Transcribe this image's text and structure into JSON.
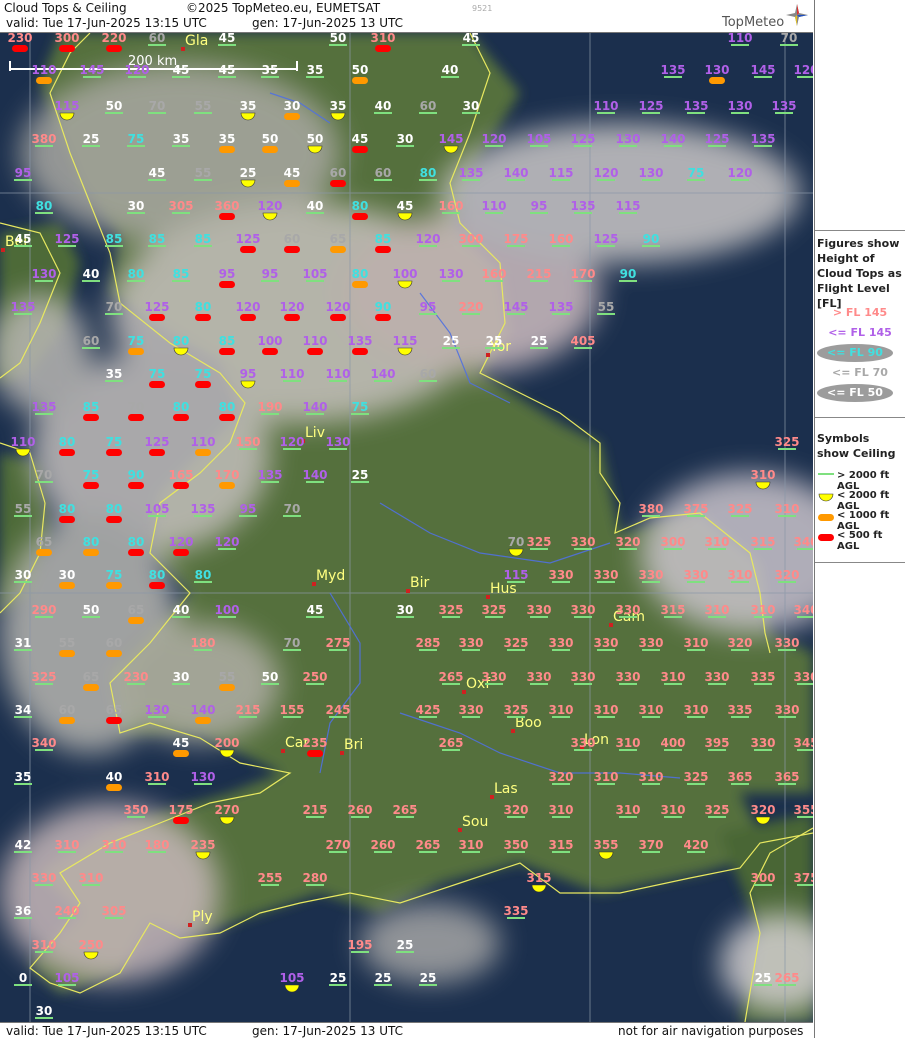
{
  "header": {
    "title": "Cloud Tops & Ceiling",
    "copyright": "©2025 TopMeteo.eu, EUMETSAT",
    "valid": "valid:  Tue  17-Jun-2025  13:15 UTC",
    "generated": "gen: 17-Jun-2025 13 UTC",
    "code": "9521",
    "brand": "TopMeteo"
  },
  "footer": {
    "valid": "valid:  Tue  17-Jun-2025  13:15 UTC",
    "generated": "gen: 17-Jun-2025 13 UTC",
    "disclaimer": "not for air navigation purposes"
  },
  "map": {
    "scale_label": "200 km",
    "cities": [
      {
        "name": "Gla"
      },
      {
        "name": "Bel"
      },
      {
        "name": "Yor"
      },
      {
        "name": "Liv"
      },
      {
        "name": "Myd"
      },
      {
        "name": "Bir"
      },
      {
        "name": "Hus"
      },
      {
        "name": "Cam"
      },
      {
        "name": "Oxf"
      },
      {
        "name": "Boo"
      },
      {
        "name": "Lon"
      },
      {
        "name": "Car"
      },
      {
        "name": "Bri"
      },
      {
        "name": "Las"
      },
      {
        "name": "Sou"
      },
      {
        "name": "Ply"
      }
    ]
  },
  "legend": {
    "tops_heading": "Figures show Height of Cloud Tops as Flight Level  [FL]",
    "tops": [
      {
        "label": "> FL 145",
        "color": "#ff8a8a"
      },
      {
        "label": "<= FL 145",
        "color": "#b060e8"
      },
      {
        "label": "<= FL 90",
        "color": "#40e0e0"
      },
      {
        "label": "<= FL 70",
        "color": "#a8a8a8"
      },
      {
        "label": "<= FL 50",
        "color": "#ffffff"
      }
    ],
    "ceiling_heading": "Symbols show Ceiling",
    "ceiling": [
      {
        "label": "> 2000 ft AGL",
        "color": "#7fe07f"
      },
      {
        "label": "< 2000 ft AGL",
        "color": "#ffff00"
      },
      {
        "label": "< 1000 ft AGL",
        "color": "#ff9900"
      },
      {
        "label": "< 500 ft AGL",
        "color": "#ff0000"
      }
    ]
  },
  "colors": {
    "high": "#ff8a8a",
    "mid": "#b060e8",
    "low": "#40e0e0",
    "lower": "#a8a8a8",
    "lowest": "#ffffff",
    "coast": "#e8e860",
    "river": "#5070e0",
    "sea": "#1a2d4a",
    "land": "#4f6a3a"
  },
  "stations": [
    {
      "v": "230",
      "s": "r"
    },
    {
      "v": "300",
      "s": "r"
    },
    {
      "v": "220",
      "s": "r"
    },
    {
      "v": "60",
      "s": "g"
    },
    {
      "v": "45",
      "s": "g"
    },
    {
      "v": "50",
      "s": "g"
    },
    {
      "v": "310",
      "s": "r"
    },
    {
      "v": "45",
      "s": "g"
    },
    {
      "v": "110",
      "s": "g"
    },
    {
      "v": "70",
      "s": "g"
    },
    {
      "v": "110",
      "s": "o"
    },
    {
      "v": "145",
      "s": "g"
    },
    {
      "v": "120",
      "s": "g"
    },
    {
      "v": "45",
      "s": "g"
    },
    {
      "v": "45",
      "s": "g"
    },
    {
      "v": "35",
      "s": "g"
    },
    {
      "v": "35",
      "s": "g"
    },
    {
      "v": "50",
      "s": "o"
    },
    {
      "v": "40",
      "s": "g"
    },
    {
      "v": "135",
      "s": "g"
    },
    {
      "v": "130",
      "s": "o"
    },
    {
      "v": "145",
      "s": "g"
    },
    {
      "v": "120",
      "s": "g"
    },
    {
      "v": "115",
      "s": "y"
    },
    {
      "v": "50",
      "s": "g"
    },
    {
      "v": "70",
      "s": "g"
    },
    {
      "v": "55",
      "s": "g"
    },
    {
      "v": "35",
      "s": "y"
    },
    {
      "v": "30",
      "s": "o"
    },
    {
      "v": "35",
      "s": "y"
    },
    {
      "v": "40",
      "s": "g"
    },
    {
      "v": "60",
      "s": "g"
    },
    {
      "v": "30",
      "s": "g"
    },
    {
      "v": "110",
      "s": "g"
    },
    {
      "v": "125",
      "s": "g"
    },
    {
      "v": "135",
      "s": "g"
    },
    {
      "v": "130",
      "s": "g"
    },
    {
      "v": "135",
      "s": "g"
    },
    {
      "v": "380",
      "s": "g"
    },
    {
      "v": "25",
      "s": "g"
    },
    {
      "v": "75",
      "s": "g"
    },
    {
      "v": "35",
      "s": "g"
    },
    {
      "v": "35",
      "s": "o"
    },
    {
      "v": "50",
      "s": "o"
    },
    {
      "v": "50",
      "s": "y"
    },
    {
      "v": "45",
      "s": "r"
    },
    {
      "v": "30",
      "s": "g"
    },
    {
      "v": "145",
      "s": "y"
    },
    {
      "v": "120",
      "s": "g"
    },
    {
      "v": "105",
      "s": "g"
    },
    {
      "v": "125",
      "s": "g"
    },
    {
      "v": "130",
      "s": "g"
    },
    {
      "v": "140",
      "s": "g"
    },
    {
      "v": "125",
      "s": "g"
    },
    {
      "v": "135",
      "s": "g"
    },
    {
      "v": "95",
      "s": "g"
    },
    {
      "v": "45",
      "s": "g"
    },
    {
      "v": "55",
      "s": "g"
    },
    {
      "v": "25",
      "s": "y"
    },
    {
      "v": "45",
      "s": "o"
    },
    {
      "v": "60",
      "s": "r"
    },
    {
      "v": "60",
      "s": "g"
    },
    {
      "v": "80",
      "s": "g"
    },
    {
      "v": "135",
      "s": "g"
    },
    {
      "v": "140",
      "s": "g"
    },
    {
      "v": "115",
      "s": "g"
    },
    {
      "v": "120",
      "s": "g"
    },
    {
      "v": "130",
      "s": "g"
    },
    {
      "v": "75",
      "s": "g"
    },
    {
      "v": "120",
      "s": "g"
    },
    {
      "v": "80",
      "s": "g"
    },
    {
      "v": "30",
      "s": "g"
    },
    {
      "v": "305",
      "s": "g"
    },
    {
      "v": "360",
      "s": "r"
    },
    {
      "v": "120",
      "s": "y"
    },
    {
      "v": "40",
      "s": "g"
    },
    {
      "v": "80",
      "s": "r"
    },
    {
      "v": "45",
      "s": "y"
    },
    {
      "v": "160",
      "s": "g"
    },
    {
      "v": "110",
      "s": "g"
    },
    {
      "v": "95",
      "s": "g"
    },
    {
      "v": "135",
      "s": "g"
    },
    {
      "v": "115",
      "s": "g"
    },
    {
      "v": "45",
      "s": "g"
    },
    {
      "v": "125",
      "s": "g"
    },
    {
      "v": "85",
      "s": "g"
    },
    {
      "v": "85",
      "s": "g"
    },
    {
      "v": "85",
      "s": "g"
    },
    {
      "v": "125",
      "s": "r"
    },
    {
      "v": "60",
      "s": "r"
    },
    {
      "v": "65",
      "s": "o"
    },
    {
      "v": "85",
      "s": "r"
    },
    {
      "v": "120",
      "s": "g"
    },
    {
      "v": "300",
      "s": "g"
    },
    {
      "v": "175",
      "s": "g"
    },
    {
      "v": "160",
      "s": "g"
    },
    {
      "v": "125",
      "s": "g"
    },
    {
      "v": "90",
      "s": "g"
    },
    {
      "v": "130",
      "s": "g"
    },
    {
      "v": "40",
      "s": "g"
    },
    {
      "v": "80",
      "s": "g"
    },
    {
      "v": "85",
      "s": "g"
    },
    {
      "v": "95",
      "s": "r"
    },
    {
      "v": "95",
      "s": "g"
    },
    {
      "v": "105",
      "s": "g"
    },
    {
      "v": "80",
      "s": "o"
    },
    {
      "v": "100",
      "s": "y"
    },
    {
      "v": "130",
      "s": "g"
    },
    {
      "v": "160",
      "s": "g"
    },
    {
      "v": "215",
      "s": "g"
    },
    {
      "v": "170",
      "s": "g"
    },
    {
      "v": "90",
      "s": "g"
    },
    {
      "v": "135",
      "s": "g"
    },
    {
      "v": "70",
      "s": "g"
    },
    {
      "v": "125",
      "s": "r"
    },
    {
      "v": "80",
      "s": "r"
    },
    {
      "v": "120",
      "s": "r"
    },
    {
      "v": "120",
      "s": "r"
    },
    {
      "v": "120",
      "s": "r"
    },
    {
      "v": "90",
      "s": "r"
    },
    {
      "v": "95",
      "s": "g"
    },
    {
      "v": "220",
      "s": "g"
    },
    {
      "v": "145",
      "s": "g"
    },
    {
      "v": "135",
      "s": "g"
    },
    {
      "v": "55",
      "s": "g"
    },
    {
      "v": "60",
      "s": "g"
    },
    {
      "v": "75",
      "s": "o"
    },
    {
      "v": "80",
      "s": "y"
    },
    {
      "v": "85",
      "s": "r"
    },
    {
      "v": "100",
      "s": "r"
    },
    {
      "v": "110",
      "s": "r"
    },
    {
      "v": "135",
      "s": "r"
    },
    {
      "v": "115",
      "s": "y"
    },
    {
      "v": "25",
      "s": "g"
    },
    {
      "v": "25",
      "s": "g"
    },
    {
      "v": "25",
      "s": "g"
    },
    {
      "v": "405",
      "s": "g"
    },
    {
      "v": "35",
      "s": "g"
    },
    {
      "v": "75",
      "s": "r"
    },
    {
      "v": "75",
      "s": "r"
    },
    {
      "v": "95",
      "s": "y"
    },
    {
      "v": "110",
      "s": "g"
    },
    {
      "v": "110",
      "s": "g"
    },
    {
      "v": "140",
      "s": "g"
    },
    {
      "v": "60",
      "s": "g"
    },
    {
      "v": "135",
      "s": "g"
    },
    {
      "v": "85",
      "s": "r"
    },
    {
      "v": "70",
      "s": "r"
    },
    {
      "v": "80",
      "s": "r"
    },
    {
      "v": "80",
      "s": "r"
    },
    {
      "v": "190",
      "s": "g"
    },
    {
      "v": "140",
      "s": "g"
    },
    {
      "v": "75",
      "s": "g"
    },
    {
      "v": "110",
      "s": "y"
    },
    {
      "v": "80",
      "s": "r"
    },
    {
      "v": "75",
      "s": "r"
    },
    {
      "v": "125",
      "s": "r"
    },
    {
      "v": "110",
      "s": "o"
    },
    {
      "v": "150",
      "s": "g"
    },
    {
      "v": "120",
      "s": "g"
    },
    {
      "v": "130",
      "s": "g"
    },
    {
      "v": "325",
      "s": "g"
    },
    {
      "v": "70",
      "s": "g"
    },
    {
      "v": "75",
      "s": "r"
    },
    {
      "v": "90",
      "s": "r"
    },
    {
      "v": "165",
      "s": "r"
    },
    {
      "v": "170",
      "s": "o"
    },
    {
      "v": "135",
      "s": "g"
    },
    {
      "v": "140",
      "s": "g"
    },
    {
      "v": "25",
      "s": "g"
    },
    {
      "v": "310",
      "s": "y"
    },
    {
      "v": "55",
      "s": "g"
    },
    {
      "v": "80",
      "s": "r"
    },
    {
      "v": "80",
      "s": "r"
    },
    {
      "v": "105",
      "s": "g"
    },
    {
      "v": "135",
      "s": "g"
    },
    {
      "v": "95",
      "s": "g"
    },
    {
      "v": "70",
      "s": "g"
    },
    {
      "v": "380",
      "s": "g"
    },
    {
      "v": "375",
      "s": "g"
    },
    {
      "v": "325",
      "s": "g"
    },
    {
      "v": "310",
      "s": "g"
    },
    {
      "v": "65",
      "s": "o"
    },
    {
      "v": "80",
      "s": "o"
    },
    {
      "v": "80",
      "s": "r"
    },
    {
      "v": "120",
      "s": "r"
    },
    {
      "v": "120",
      "s": "g"
    },
    {
      "v": "70",
      "s": "y"
    },
    {
      "v": "325",
      "s": "g"
    },
    {
      "v": "330",
      "s": "g"
    },
    {
      "v": "320",
      "s": "g"
    },
    {
      "v": "300",
      "s": "g"
    },
    {
      "v": "310",
      "s": "g"
    },
    {
      "v": "315",
      "s": "g"
    },
    {
      "v": "340",
      "s": "g"
    },
    {
      "v": "30",
      "s": "g"
    },
    {
      "v": "30",
      "s": "o"
    },
    {
      "v": "75",
      "s": "o"
    },
    {
      "v": "80",
      "s": "r"
    },
    {
      "v": "80",
      "s": "g"
    },
    {
      "v": "115",
      "s": "g"
    },
    {
      "v": "330",
      "s": "g"
    },
    {
      "v": "330",
      "s": "g"
    },
    {
      "v": "330",
      "s": "g"
    },
    {
      "v": "330",
      "s": "g"
    },
    {
      "v": "310",
      "s": "g"
    },
    {
      "v": "320",
      "s": "g"
    },
    {
      "v": "290",
      "s": "g"
    },
    {
      "v": "50",
      "s": "g"
    },
    {
      "v": "65",
      "s": "o"
    },
    {
      "v": "40",
      "s": "g"
    },
    {
      "v": "100",
      "s": "g"
    },
    {
      "v": "45",
      "s": "g"
    },
    {
      "v": "30",
      "s": "g"
    },
    {
      "v": "325",
      "s": "g"
    },
    {
      "v": "325",
      "s": "g"
    },
    {
      "v": "330",
      "s": "g"
    },
    {
      "v": "330",
      "s": "g"
    },
    {
      "v": "330",
      "s": "g"
    },
    {
      "v": "315",
      "s": "g"
    },
    {
      "v": "310",
      "s": "g"
    },
    {
      "v": "310",
      "s": "g"
    },
    {
      "v": "340",
      "s": "g"
    },
    {
      "v": "31",
      "s": "g"
    },
    {
      "v": "55",
      "s": "o"
    },
    {
      "v": "60",
      "s": "o"
    },
    {
      "v": "180",
      "s": "g"
    },
    {
      "v": "70",
      "s": "g"
    },
    {
      "v": "275",
      "s": "g"
    },
    {
      "v": "285",
      "s": "g"
    },
    {
      "v": "330",
      "s": "g"
    },
    {
      "v": "325",
      "s": "g"
    },
    {
      "v": "330",
      "s": "g"
    },
    {
      "v": "330",
      "s": "g"
    },
    {
      "v": "330",
      "s": "g"
    },
    {
      "v": "310",
      "s": "g"
    },
    {
      "v": "320",
      "s": "g"
    },
    {
      "v": "330",
      "s": "g"
    },
    {
      "v": "325",
      "s": "g"
    },
    {
      "v": "65",
      "s": "o"
    },
    {
      "v": "230",
      "s": "g"
    },
    {
      "v": "30",
      "s": "g"
    },
    {
      "v": "55",
      "s": "o"
    },
    {
      "v": "50",
      "s": "g"
    },
    {
      "v": "250",
      "s": "g"
    },
    {
      "v": "265",
      "s": "g"
    },
    {
      "v": "330",
      "s": "g"
    },
    {
      "v": "330",
      "s": "g"
    },
    {
      "v": "330",
      "s": "g"
    },
    {
      "v": "330",
      "s": "g"
    },
    {
      "v": "310",
      "s": "g"
    },
    {
      "v": "330",
      "s": "g"
    },
    {
      "v": "335",
      "s": "g"
    },
    {
      "v": "330",
      "s": "g"
    },
    {
      "v": "34",
      "s": "g"
    },
    {
      "v": "60",
      "s": "o"
    },
    {
      "v": "65",
      "s": "r"
    },
    {
      "v": "130",
      "s": "g"
    },
    {
      "v": "140",
      "s": "o"
    },
    {
      "v": "215",
      "s": "g"
    },
    {
      "v": "155",
      "s": "g"
    },
    {
      "v": "245",
      "s": "g"
    },
    {
      "v": "425",
      "s": "g"
    },
    {
      "v": "330",
      "s": "g"
    },
    {
      "v": "325",
      "s": "g"
    },
    {
      "v": "310",
      "s": "g"
    },
    {
      "v": "310",
      "s": "g"
    },
    {
      "v": "310",
      "s": "g"
    },
    {
      "v": "310",
      "s": "g"
    },
    {
      "v": "335",
      "s": "g"
    },
    {
      "v": "330",
      "s": "g"
    },
    {
      "v": "340",
      "s": "g"
    },
    {
      "v": "45",
      "s": "o"
    },
    {
      "v": "200",
      "s": "y"
    },
    {
      "v": "235",
      "s": "r"
    },
    {
      "v": "265",
      "s": "g"
    },
    {
      "v": "330",
      "s": "g"
    },
    {
      "v": "310",
      "s": "g"
    },
    {
      "v": "400",
      "s": "g"
    },
    {
      "v": "395",
      "s": "g"
    },
    {
      "v": "330",
      "s": "g"
    },
    {
      "v": "345",
      "s": "g"
    },
    {
      "v": "35",
      "s": "g"
    },
    {
      "v": "40",
      "s": "o"
    },
    {
      "v": "310",
      "s": "g"
    },
    {
      "v": "130",
      "s": "g"
    },
    {
      "v": "320",
      "s": "g"
    },
    {
      "v": "310",
      "s": "g"
    },
    {
      "v": "310",
      "s": "g"
    },
    {
      "v": "325",
      "s": "g"
    },
    {
      "v": "365",
      "s": "g"
    },
    {
      "v": "365",
      "s": "g"
    },
    {
      "v": "350",
      "s": "g"
    },
    {
      "v": "175",
      "s": "r"
    },
    {
      "v": "270",
      "s": "y"
    },
    {
      "v": "215",
      "s": "g"
    },
    {
      "v": "260",
      "s": "g"
    },
    {
      "v": "265",
      "s": "g"
    },
    {
      "v": "320",
      "s": "g"
    },
    {
      "v": "310",
      "s": "g"
    },
    {
      "v": "310",
      "s": "g"
    },
    {
      "v": "310",
      "s": "g"
    },
    {
      "v": "325",
      "s": "g"
    },
    {
      "v": "320",
      "s": "y"
    },
    {
      "v": "355",
      "s": "g"
    },
    {
      "v": "42",
      "s": "g"
    },
    {
      "v": "310",
      "s": "g"
    },
    {
      "v": "310",
      "s": "g"
    },
    {
      "v": "180",
      "s": "g"
    },
    {
      "v": "235",
      "s": "y"
    },
    {
      "v": "270",
      "s": "g"
    },
    {
      "v": "260",
      "s": "g"
    },
    {
      "v": "265",
      "s": "g"
    },
    {
      "v": "310",
      "s": "g"
    },
    {
      "v": "350",
      "s": "g"
    },
    {
      "v": "315",
      "s": "g"
    },
    {
      "v": "355",
      "s": "y"
    },
    {
      "v": "370",
      "s": "g"
    },
    {
      "v": "420",
      "s": "g"
    },
    {
      "v": "330",
      "s": "g"
    },
    {
      "v": "310",
      "s": "g"
    },
    {
      "v": "255",
      "s": "g"
    },
    {
      "v": "280",
      "s": "g"
    },
    {
      "v": "315",
      "s": "y"
    },
    {
      "v": "300",
      "s": "g"
    },
    {
      "v": "375",
      "s": "g"
    },
    {
      "v": "36",
      "s": "g"
    },
    {
      "v": "240",
      "s": "g"
    },
    {
      "v": "305",
      "s": "g"
    },
    {
      "v": "335",
      "s": "g"
    },
    {
      "v": "310",
      "s": "g"
    },
    {
      "v": "250",
      "s": "y"
    },
    {
      "v": "195",
      "s": "g"
    },
    {
      "v": "25",
      "s": "g"
    },
    {
      "v": "0",
      "s": "g"
    },
    {
      "v": "105",
      "s": "g"
    },
    {
      "v": "105",
      "s": "y"
    },
    {
      "v": "25",
      "s": "g"
    },
    {
      "v": "25",
      "s": "g"
    },
    {
      "v": "25",
      "s": "g"
    },
    {
      "v": "265",
      "s": "g"
    },
    {
      "v": "25",
      "s": "g"
    },
    {
      "v": "30",
      "s": "g"
    },
    {
      "v": "100",
      "s": "g"
    }
  ]
}
